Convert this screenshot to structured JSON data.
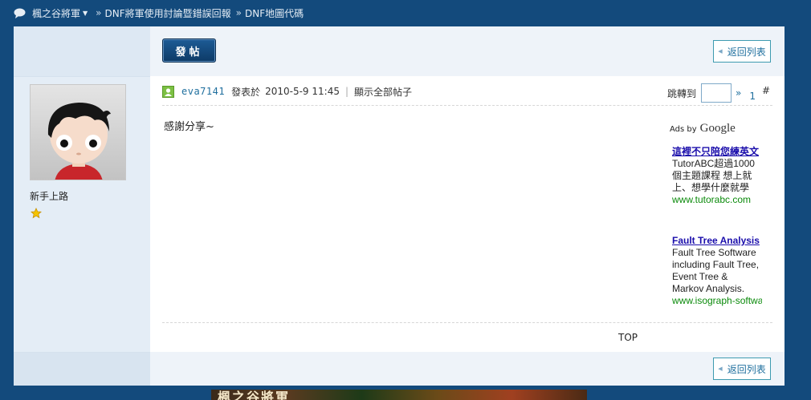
{
  "breadcrumb": {
    "home": "楓之谷將軍",
    "forum": "DNF將軍使用討論暨錯誤回報",
    "thread": "DNF地圖代碼",
    "separator": "»"
  },
  "toolbar": {
    "post_label": "發帖",
    "back_label": "返回列表"
  },
  "author": {
    "rank": "新手上路"
  },
  "post": {
    "username": "eva7141",
    "posted_prefix": "發表於",
    "datetime": "2010-5-9 11:45",
    "meta_sep": "|",
    "show_all": "顯示全部帖子",
    "jump_label": "跳轉到",
    "jump_go": "»",
    "page": "1",
    "hash": "#",
    "message": "感謝分享~",
    "top_link": "TOP"
  },
  "ads": {
    "label_prefix": "Ads by",
    "label_brand": "Google",
    "items": [
      {
        "title": "這裡不只陪您練英文",
        "body": "TutorABC超過1000個主題課程 想上就上、想學什麼就學",
        "url": "www.tutorabc.com"
      },
      {
        "title": "Fault Tree Analysis",
        "body": "Fault Tree Software including Fault Tree, Event Tree & Markov Analysis.",
        "url": "www.isograph-software.com"
      }
    ]
  },
  "banner": {
    "text": "楓之谷將軍"
  },
  "colors": {
    "page_bg": "#134a7c",
    "link": "#1f6f9e",
    "ad_title": "#1a0dab",
    "ad_url": "#0a8a0a"
  }
}
